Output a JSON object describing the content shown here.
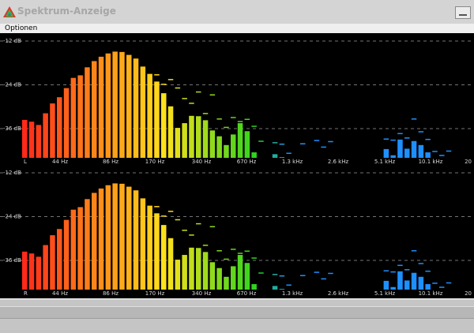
{
  "window": {
    "title": "Spektrum-Anzeige",
    "app_icon": "triangle-logo-icon",
    "minimize_icon": "minimize-icon"
  },
  "menu": {
    "items": [
      {
        "label": "Optionen"
      }
    ]
  },
  "colors": {
    "background": "#000000",
    "grid": "#9a9a9a",
    "low": "#ff2a1a",
    "mid": "#ffe11a",
    "high": "#27d41e",
    "top": "#1e8fff"
  },
  "spectrum": {
    "db_labels": [
      "-12 dB",
      "-24 dB",
      "-36 dB"
    ],
    "freq_labels": [
      "44 Hz",
      "86 Hz",
      "170 Hz",
      "340 Hz",
      "670 Hz",
      "1.3 kHz",
      "2.6 kHz",
      "5.1 kHz",
      "10.1 kHz",
      "20"
    ],
    "channels": [
      {
        "name": "L",
        "bands": [
          {
            "level": -33.6,
            "peak": null
          },
          {
            "level": -34.1,
            "peak": null
          },
          {
            "level": -35.0,
            "peak": null
          },
          {
            "level": -31.8,
            "peak": null
          },
          {
            "level": -29.1,
            "peak": null
          },
          {
            "level": -27.4,
            "peak": null
          },
          {
            "level": -24.9,
            "peak": null
          },
          {
            "level": -22.1,
            "peak": null
          },
          {
            "level": -21.4,
            "peak": null
          },
          {
            "level": -19.2,
            "peak": null
          },
          {
            "level": -17.5,
            "peak": null
          },
          {
            "level": -16.3,
            "peak": null
          },
          {
            "level": -15.4,
            "peak": null
          },
          {
            "level": -14.9,
            "peak": null
          },
          {
            "level": -15.0,
            "peak": null
          },
          {
            "level": -15.8,
            "peak": null
          },
          {
            "level": -16.8,
            "peak": null
          },
          {
            "level": -19.0,
            "peak": null
          },
          {
            "level": -21.0,
            "peak": null
          },
          {
            "level": -23.1,
            "peak": -21.1
          },
          {
            "level": -26.3,
            "peak": -23.7
          },
          {
            "level": -29.9,
            "peak": -22.4
          },
          {
            "level": -35.8,
            "peak": -24.7
          },
          {
            "level": -34.5,
            "peak": -27.6
          },
          {
            "level": -32.5,
            "peak": -28.9
          },
          {
            "level": -32.6,
            "peak": -25.8
          },
          {
            "level": -33.7,
            "peak": -31.7
          },
          {
            "level": -36.5,
            "peak": -26.6
          },
          {
            "level": -38.1,
            "peak": -33.2
          },
          {
            "level": -40.5,
            "peak": -35.5
          },
          {
            "level": -37.6,
            "peak": -32.8
          },
          {
            "level": -34.5,
            "peak": -33.9
          },
          {
            "level": -36.7,
            "peak": -33.3
          },
          {
            "level": -42.5,
            "peak": -35.2
          },
          {
            "level": null,
            "peak": -39.3
          },
          {
            "level": null,
            "peak": null
          },
          {
            "level": -43.0,
            "peak": -39.7
          },
          {
            "level": -43.8,
            "peak": -40.1
          },
          {
            "level": null,
            "peak": -42.6
          },
          {
            "level": null,
            "peak": null
          },
          {
            "level": null,
            "peak": -40.0
          },
          {
            "level": null,
            "peak": null
          },
          {
            "level": null,
            "peak": -39.1
          },
          {
            "level": null,
            "peak": -40.9
          },
          {
            "level": null,
            "peak": -39.4
          },
          {
            "level": null,
            "peak": null
          },
          {
            "level": null,
            "peak": null
          },
          {
            "level": null,
            "peak": null
          },
          {
            "level": null,
            "peak": null
          },
          {
            "level": null,
            "peak": null
          },
          {
            "level": null,
            "peak": null
          },
          {
            "level": null,
            "peak": null
          },
          {
            "level": -41.6,
            "peak": -38.7
          },
          {
            "level": -43.3,
            "peak": -39.0
          },
          {
            "level": -39.0,
            "peak": -37.2
          },
          {
            "level": -41.5,
            "peak": -38.4
          },
          {
            "level": -39.4,
            "peak": -33.2
          },
          {
            "level": -40.5,
            "peak": -36.7
          },
          {
            "level": -42.5,
            "peak": -38.8
          },
          {
            "level": null,
            "peak": -42.1
          },
          {
            "level": null,
            "peak": -43.2
          },
          {
            "level": null,
            "peak": -42.0
          }
        ]
      },
      {
        "name": "R",
        "bands": [
          {
            "level": -33.6,
            "peak": null
          },
          {
            "level": -34.1,
            "peak": null
          },
          {
            "level": -35.0,
            "peak": null
          },
          {
            "level": -31.8,
            "peak": null
          },
          {
            "level": -29.1,
            "peak": null
          },
          {
            "level": -27.4,
            "peak": null
          },
          {
            "level": -24.9,
            "peak": null
          },
          {
            "level": -22.1,
            "peak": null
          },
          {
            "level": -21.4,
            "peak": null
          },
          {
            "level": -19.2,
            "peak": null
          },
          {
            "level": -17.5,
            "peak": null
          },
          {
            "level": -16.3,
            "peak": null
          },
          {
            "level": -15.4,
            "peak": null
          },
          {
            "level": -14.9,
            "peak": null
          },
          {
            "level": -15.0,
            "peak": null
          },
          {
            "level": -15.8,
            "peak": null
          },
          {
            "level": -16.8,
            "peak": null
          },
          {
            "level": -19.0,
            "peak": null
          },
          {
            "level": -21.0,
            "peak": null
          },
          {
            "level": -23.1,
            "peak": -21.1
          },
          {
            "level": -26.3,
            "peak": -23.7
          },
          {
            "level": -29.9,
            "peak": -22.4
          },
          {
            "level": -35.8,
            "peak": -24.7
          },
          {
            "level": -34.5,
            "peak": -27.6
          },
          {
            "level": -32.5,
            "peak": -28.9
          },
          {
            "level": -32.6,
            "peak": -25.8
          },
          {
            "level": -33.7,
            "peak": -31.7
          },
          {
            "level": -36.5,
            "peak": -26.6
          },
          {
            "level": -38.1,
            "peak": -33.2
          },
          {
            "level": -40.5,
            "peak": -35.5
          },
          {
            "level": -37.6,
            "peak": -32.8
          },
          {
            "level": -34.5,
            "peak": -33.9
          },
          {
            "level": -36.7,
            "peak": -33.3
          },
          {
            "level": -42.5,
            "peak": -35.2
          },
          {
            "level": null,
            "peak": -39.3
          },
          {
            "level": null,
            "peak": null
          },
          {
            "level": -43.0,
            "peak": -39.7
          },
          {
            "level": -43.8,
            "peak": -40.1
          },
          {
            "level": null,
            "peak": -42.6
          },
          {
            "level": null,
            "peak": null
          },
          {
            "level": null,
            "peak": -40.0
          },
          {
            "level": null,
            "peak": null
          },
          {
            "level": null,
            "peak": -39.1
          },
          {
            "level": null,
            "peak": -40.9
          },
          {
            "level": null,
            "peak": -39.4
          },
          {
            "level": null,
            "peak": null
          },
          {
            "level": null,
            "peak": null
          },
          {
            "level": null,
            "peak": null
          },
          {
            "level": null,
            "peak": null
          },
          {
            "level": null,
            "peak": null
          },
          {
            "level": null,
            "peak": null
          },
          {
            "level": null,
            "peak": null
          },
          {
            "level": -41.6,
            "peak": -38.7
          },
          {
            "level": -43.3,
            "peak": -39.0
          },
          {
            "level": -39.0,
            "peak": -37.2
          },
          {
            "level": -41.5,
            "peak": -38.4
          },
          {
            "level": -39.4,
            "peak": -33.2
          },
          {
            "level": -40.5,
            "peak": -36.7
          },
          {
            "level": -42.5,
            "peak": -38.8
          },
          {
            "level": null,
            "peak": -42.1
          },
          {
            "level": null,
            "peak": -43.2
          },
          {
            "level": null,
            "peak": -42.0
          }
        ]
      }
    ]
  }
}
